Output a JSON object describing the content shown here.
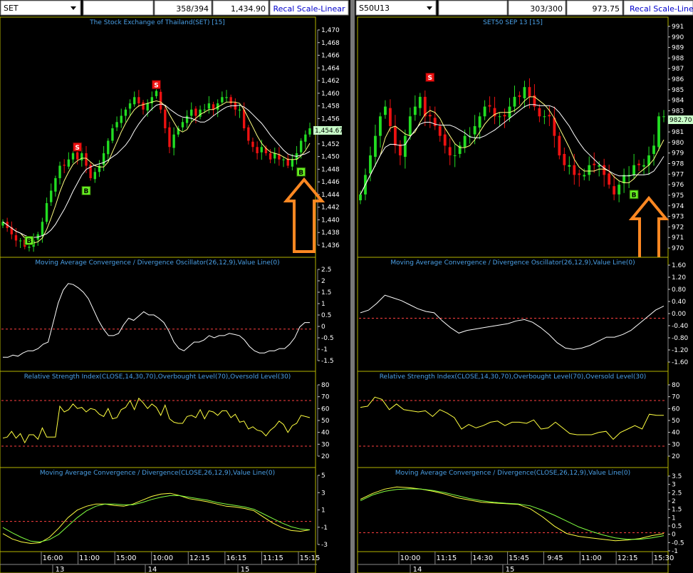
{
  "colors": {
    "background": "#000000",
    "panel_border": "#b4b400",
    "title_text": "#4aa0e6",
    "axis_text": "#ffffff",
    "up_candle": "#22dd22",
    "down_candle": "#ee1111",
    "ma_fast": "#ffff80",
    "ma_slow": "#ffffff",
    "macd_line": "#ffffff",
    "rsi_line": "#ffff40",
    "macd2_a": "#ffff40",
    "macd2_b": "#80ff40",
    "ref_line": "#ff4040",
    "buy_marker": "#66ee22",
    "sell_marker": "#ee1111",
    "arrow": "#ff8822",
    "toolbar_bg": "#ffffff",
    "recal_text": "#0000cc",
    "splitter": "#777777"
  },
  "icons": {
    "dropdown": "chevron-down-icon",
    "arrow": "up-arrow-icon"
  },
  "left": {
    "symbol": "SET",
    "counter": "358/394",
    "last_price": "1,434.90",
    "recal": "Recal Scale-Linear",
    "price_title": "The Stock Exchange of Thailand(SET) [15]",
    "price_ticks": [
      "1,470",
      "1,468",
      "1,466",
      "1,464",
      "1,462",
      "1,460",
      "1,458",
      "1,456",
      "1,454",
      "1,452",
      "1,450",
      "1,448",
      "1,446",
      "1,444",
      "1,442",
      "1,440",
      "1,438",
      "1,436"
    ],
    "current_price": "1,454.67",
    "macd_osc_title": "Moving Average Convergence / Divergence Oscillator(26,12,9),Value Line(0)",
    "macd_osc_ticks": [
      "2.5",
      "2",
      "1.5",
      "1",
      "0.5",
      "0",
      "-0.5",
      "-1",
      "-1.5"
    ],
    "rsi_title": "Relative Strength Index(CLOSE,14,30,70),Overbought Level(70),Oversold Level(30)",
    "rsi_ticks": [
      "80",
      "70",
      "60",
      "50",
      "40",
      "30",
      "20"
    ],
    "macd_title": "Moving Average Convergence / Divergence(CLOSE,26,12,9),Value Line(0)",
    "macd_ticks": [
      "5",
      "3",
      "1",
      "-1",
      "-3"
    ],
    "time_labels": [
      "16:00",
      "11:00",
      "15:00",
      "10:00",
      "12:15",
      "16:15",
      "11:15",
      "15:15"
    ],
    "date_labels": [
      "13",
      "14",
      "15"
    ],
    "signal_labels": [
      "B",
      "S",
      "B",
      "S",
      "B"
    ]
  },
  "right": {
    "symbol": "S50U13",
    "counter": "303/300",
    "last_price": "973.75",
    "recal": "Recal Scale-Linear",
    "price_title": "SET50 SEP 13   [15]",
    "price_ticks": [
      "991",
      "990",
      "989",
      "988",
      "987",
      "986",
      "985",
      "984",
      "983",
      "982",
      "981",
      "980",
      "979",
      "978",
      "977",
      "976",
      "975",
      "974",
      "973",
      "972",
      "971",
      "970"
    ],
    "current_price": "982.70",
    "macd_osc_title": "Moving Average Convergence / Divergence Oscillator(26,12,9),Value Line(0)",
    "macd_osc_ticks": [
      "1.60",
      "1.20",
      "0.80",
      "0.40",
      "0.00",
      "-0.40",
      "-0.80",
      "-1.20",
      "-1.60"
    ],
    "rsi_title": "Relative Strength Index(CLOSE,14,30,70),Overbought Level(70),Oversold Level(30)",
    "rsi_ticks": [
      "80",
      "70",
      "60",
      "50",
      "40",
      "30",
      "20"
    ],
    "macd_title": "Moving Average Convergence / Divergence(CLOSE,26,12,9),Value Line(0)",
    "macd_ticks": [
      "3.5",
      "3",
      "2.5",
      "2",
      "1.5",
      "1",
      "0.5",
      "0",
      "-0.5",
      "-1"
    ],
    "time_labels": [
      "10:00",
      "11:15",
      "14:30",
      "15:45",
      "9:45",
      "11:00",
      "12:15",
      "15:30"
    ],
    "date_labels": [
      "14",
      "15"
    ],
    "signal_labels": [
      "S",
      "B"
    ]
  },
  "chart_data": [
    {
      "type": "candlestick",
      "series": "SET",
      "ylim": [
        1435,
        1471
      ],
      "close": [
        1440,
        1439,
        1438,
        1437,
        1437,
        1436,
        1436,
        1437,
        1438,
        1440,
        1443,
        1445,
        1447,
        1449,
        1449,
        1450,
        1451,
        1450,
        1451,
        1449,
        1447,
        1448,
        1449,
        1451,
        1453,
        1455,
        1456,
        1457,
        1458,
        1459,
        1460,
        1459,
        1458,
        1459,
        1460,
        1461,
        1458,
        1455,
        1452,
        1454,
        1455,
        1456,
        1457,
        1458,
        1457,
        1458,
        1458,
        1459,
        1458,
        1459,
        1460,
        1460,
        1459,
        1458,
        1458,
        1455,
        1453,
        1452,
        1451,
        1452,
        1451,
        1450,
        1451,
        1450,
        1450,
        1449,
        1450,
        1451,
        1453,
        1454,
        1455
      ],
      "signals": [
        {
          "label": "B",
          "index": 6,
          "price": 1437
        },
        {
          "label": "S",
          "index": 17,
          "price": 1452
        },
        {
          "label": "B",
          "index": 19,
          "price": 1445
        },
        {
          "label": "S",
          "index": 35,
          "price": 1462
        },
        {
          "label": "B",
          "index": 68,
          "price": 1448
        }
      ]
    },
    {
      "type": "candlestick",
      "series": "S50U13",
      "ylim": [
        969,
        992
      ],
      "close": [
        975,
        977,
        979,
        981,
        983,
        984,
        982,
        980,
        979,
        981,
        983,
        984,
        985,
        983,
        983,
        982,
        981,
        980,
        979,
        979,
        980,
        981,
        981,
        982,
        983,
        984,
        984,
        983,
        983,
        983,
        984,
        985,
        985,
        986,
        985,
        984,
        983,
        983,
        983,
        981,
        979,
        978,
        978,
        977,
        977,
        977,
        978,
        978,
        978,
        977,
        976,
        975,
        976,
        977,
        977,
        978,
        978,
        978,
        979,
        980,
        983,
        983
      ],
      "signals": [
        {
          "label": "S",
          "index": 14,
          "price": 987
        },
        {
          "label": "B",
          "index": 55,
          "price": 975
        }
      ]
    },
    {
      "type": "line",
      "series": "SET MACD Oscillator",
      "ylim": [
        -1.75,
        2.75
      ],
      "values": [
        -1.3,
        -1.3,
        -1.2,
        -1.25,
        -1.1,
        -1.0,
        -1.0,
        -0.9,
        -0.7,
        -0.6,
        0.3,
        1.2,
        1.8,
        2.1,
        2.05,
        1.9,
        1.7,
        1.4,
        0.9,
        0.4,
        0.0,
        -0.3,
        -0.3,
        -0.2,
        0.2,
        0.5,
        0.4,
        0.6,
        0.8,
        0.65,
        0.65,
        0.5,
        0.3,
        -0.1,
        -0.6,
        -0.9,
        -1.0,
        -0.8,
        -0.6,
        -0.6,
        -0.5,
        -0.3,
        -0.4,
        -0.3,
        -0.3,
        -0.2,
        -0.25,
        -0.3,
        -0.5,
        -0.8,
        -1.0,
        -1.1,
        -1.1,
        -1.0,
        -1.0,
        -0.9,
        -0.9,
        -0.7,
        -0.4,
        0.1,
        0.3,
        0.3
      ]
    },
    {
      "type": "line",
      "series": "SET RSI",
      "ylim": [
        15,
        85
      ],
      "values": [
        37,
        38,
        43,
        37,
        41,
        33,
        40,
        40,
        36,
        46,
        38,
        38,
        38,
        65,
        60,
        62,
        67,
        63,
        64,
        60,
        63,
        62,
        58,
        56,
        63,
        54,
        55,
        62,
        64,
        70,
        62,
        72,
        68,
        63,
        67,
        64,
        57,
        66,
        54,
        51,
        50,
        50,
        56,
        57,
        55,
        62,
        54,
        61,
        60,
        57,
        61,
        61,
        55,
        58,
        51,
        52,
        45,
        47,
        44,
        43,
        39,
        44,
        47,
        52,
        49,
        42,
        48,
        50,
        57,
        56,
        55
      ],
      "overbought": 70,
      "oversold": 30
    },
    {
      "type": "line",
      "series": "SET MACD",
      "ylim": [
        -3.6,
        5.6
      ],
      "series_a": [
        -1.6,
        -2.3,
        -2.7,
        -2.9,
        -2.8,
        -2.1,
        -0.9,
        0.5,
        1.5,
        2.0,
        2.3,
        2.3,
        2.1,
        2.0,
        2.3,
        2.8,
        3.3,
        3.6,
        3.7,
        3.4,
        3.0,
        2.8,
        2.6,
        2.3,
        2.0,
        1.9,
        1.7,
        1.4,
        0.6,
        -0.2,
        -0.8,
        -1.2,
        -1.3,
        -1.1
      ],
      "series_b": [
        -0.8,
        -1.5,
        -2.1,
        -2.6,
        -2.7,
        -2.4,
        -1.7,
        -0.6,
        0.5,
        1.4,
        2.0,
        2.3,
        2.3,
        2.2,
        2.2,
        2.5,
        2.9,
        3.2,
        3.4,
        3.4,
        3.2,
        3.0,
        2.8,
        2.5,
        2.3,
        2.1,
        1.9,
        1.6,
        1.0,
        0.4,
        -0.2,
        -0.7,
        -1.0,
        -1.1
      ],
      "zero_line": 0
    },
    {
      "type": "line",
      "series": "S50U13 MACD Oscillator",
      "ylim": [
        -1.8,
        1.8
      ],
      "values": [
        0.2,
        0.3,
        0.55,
        0.85,
        0.75,
        0.65,
        0.5,
        0.35,
        0.25,
        0.2,
        -0.1,
        -0.35,
        -0.55,
        -0.45,
        -0.4,
        -0.35,
        -0.3,
        -0.25,
        -0.2,
        -0.1,
        -0.05,
        -0.15,
        -0.35,
        -0.6,
        -0.9,
        -1.1,
        -1.15,
        -1.1,
        -1.0,
        -0.85,
        -0.7,
        -0.7,
        -0.6,
        -0.45,
        -0.2,
        0.05,
        0.3,
        0.45
      ]
    },
    {
      "type": "line",
      "series": "S50U13 RSI",
      "ylim": [
        15,
        85
      ],
      "values": [
        64,
        65,
        73,
        71,
        62,
        67,
        62,
        61,
        60,
        61,
        56,
        62,
        59,
        55,
        45,
        49,
        46,
        48,
        51,
        52,
        48,
        51,
        51,
        50,
        53,
        45,
        46,
        51,
        46,
        41,
        40,
        40,
        40,
        42,
        43,
        36,
        42,
        45,
        48,
        45,
        58,
        57,
        57
      ],
      "overbought": 70,
      "oversold": 30
    },
    {
      "type": "line",
      "series": "S50U13 MACD",
      "ylim": [
        -1.1,
        3.7
      ],
      "series_a": [
        2.3,
        2.7,
        3.0,
        3.15,
        3.1,
        3.0,
        2.85,
        2.65,
        2.4,
        2.25,
        2.1,
        2.05,
        2.0,
        1.95,
        1.65,
        1.1,
        0.45,
        -0.05,
        -0.25,
        -0.35,
        -0.45,
        -0.55,
        -0.5,
        -0.4,
        -0.2,
        -0.05
      ],
      "series_b": [
        2.2,
        2.6,
        2.85,
        2.98,
        3.02,
        3.0,
        2.9,
        2.75,
        2.55,
        2.35,
        2.2,
        2.1,
        2.03,
        1.98,
        1.85,
        1.55,
        1.2,
        0.8,
        0.4,
        0.1,
        -0.15,
        -0.35,
        -0.45,
        -0.45,
        -0.35,
        -0.2
      ],
      "zero_line": 0
    }
  ]
}
